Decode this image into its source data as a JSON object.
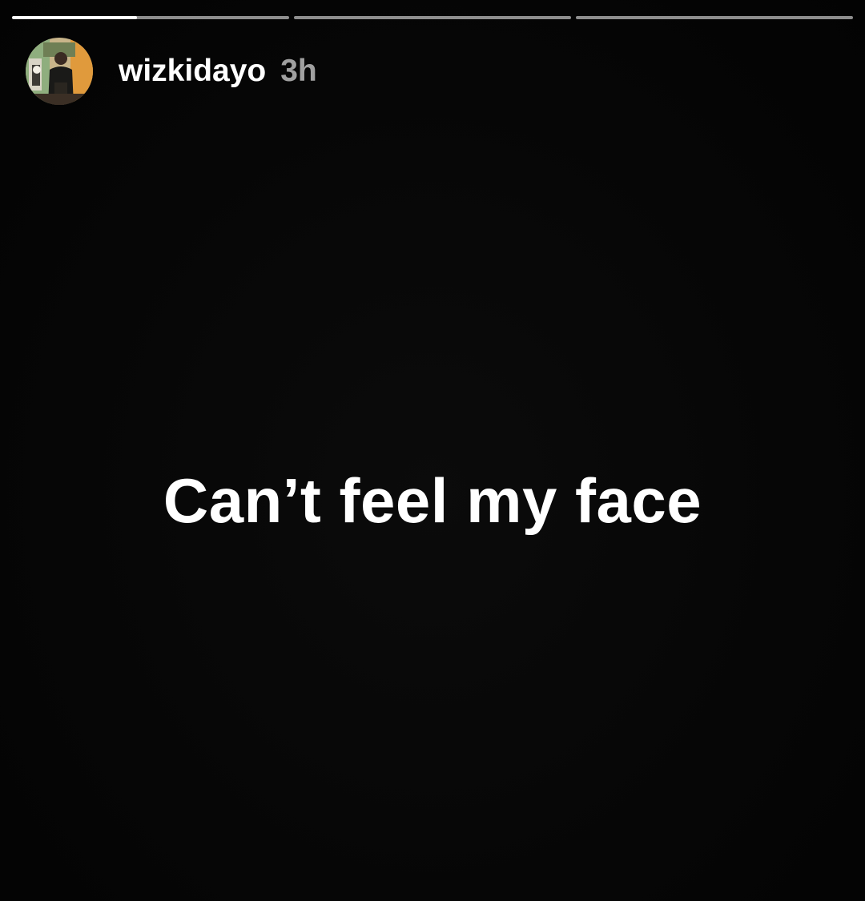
{
  "story": {
    "progress": [
      {
        "fill": 0.45
      },
      {
        "fill": 0
      },
      {
        "fill": 0
      }
    ],
    "user": {
      "username": "wizkidayo",
      "avatar_icon": "profile-photo",
      "time_ago": "3h"
    },
    "caption": "Can’t feel my face"
  },
  "colors": {
    "background": "#050505",
    "text": "#ffffff",
    "progress_track": "rgba(255,255,255,0.55)",
    "progress_fill": "#ffffff"
  }
}
